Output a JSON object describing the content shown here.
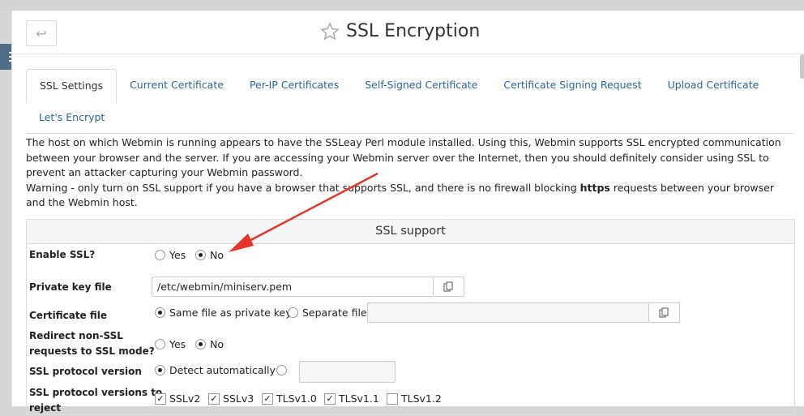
{
  "header": {
    "back_icon": "↩",
    "title": "SSL Encryption"
  },
  "tabs": [
    {
      "label": "SSL Settings",
      "active": true
    },
    {
      "label": "Current Certificate"
    },
    {
      "label": "Per-IP Certificates"
    },
    {
      "label": "Self-Signed Certificate"
    },
    {
      "label": "Certificate Signing Request"
    },
    {
      "label": "Upload Certificate"
    },
    {
      "label": "Let's Encrypt"
    }
  ],
  "intro": {
    "para1": "The host on which Webmin is running appears to have the SSLeay Perl module installed. Using this, Webmin supports SSL encrypted communication between your browser and the server. If you are accessing your Webmin server over the Internet, then you should definitely consider using SSL to prevent an attacker capturing your Webmin password.",
    "warn_pre": "Warning - only turn on SSL support if you have a browser that supports SSL, and there is no firewall blocking ",
    "warn_bold": "https",
    "warn_post": " requests between your browser and the Webmin host."
  },
  "section": {
    "title": "SSL support",
    "enable_ssl": {
      "label": "Enable SSL?",
      "yes": "Yes",
      "no": "No",
      "selected": "No"
    },
    "private_key": {
      "label": "Private key file",
      "value": "/etc/webmin/miniserv.pem"
    },
    "certificate": {
      "label": "Certificate file",
      "opt_same": "Same file as private key",
      "opt_separate": "Separate file",
      "selected": "Same file as private key",
      "value": ""
    },
    "redirect": {
      "label_line1": "Redirect non-SSL",
      "label_line2": "requests to SSL mode?",
      "yes": "Yes",
      "no": "No",
      "selected": "No"
    },
    "protocol": {
      "label": "SSL protocol version",
      "opt_auto": "Detect automatically",
      "selected": "Detect automatically",
      "value": ""
    },
    "reject": {
      "label_line1": "SSL protocol versions to",
      "label_line2": "reject",
      "options": [
        {
          "label": "SSLv2",
          "checked": true
        },
        {
          "label": "SSLv3",
          "checked": true
        },
        {
          "label": "TLSv1.0",
          "checked": true
        },
        {
          "label": "TLSv1.1",
          "checked": true
        },
        {
          "label": "TLSv1.2",
          "checked": false
        }
      ]
    }
  },
  "colors": {
    "accent_link": "#2b65a1",
    "menu_bg": "#4f6d86",
    "arrow": "#e8332a"
  }
}
